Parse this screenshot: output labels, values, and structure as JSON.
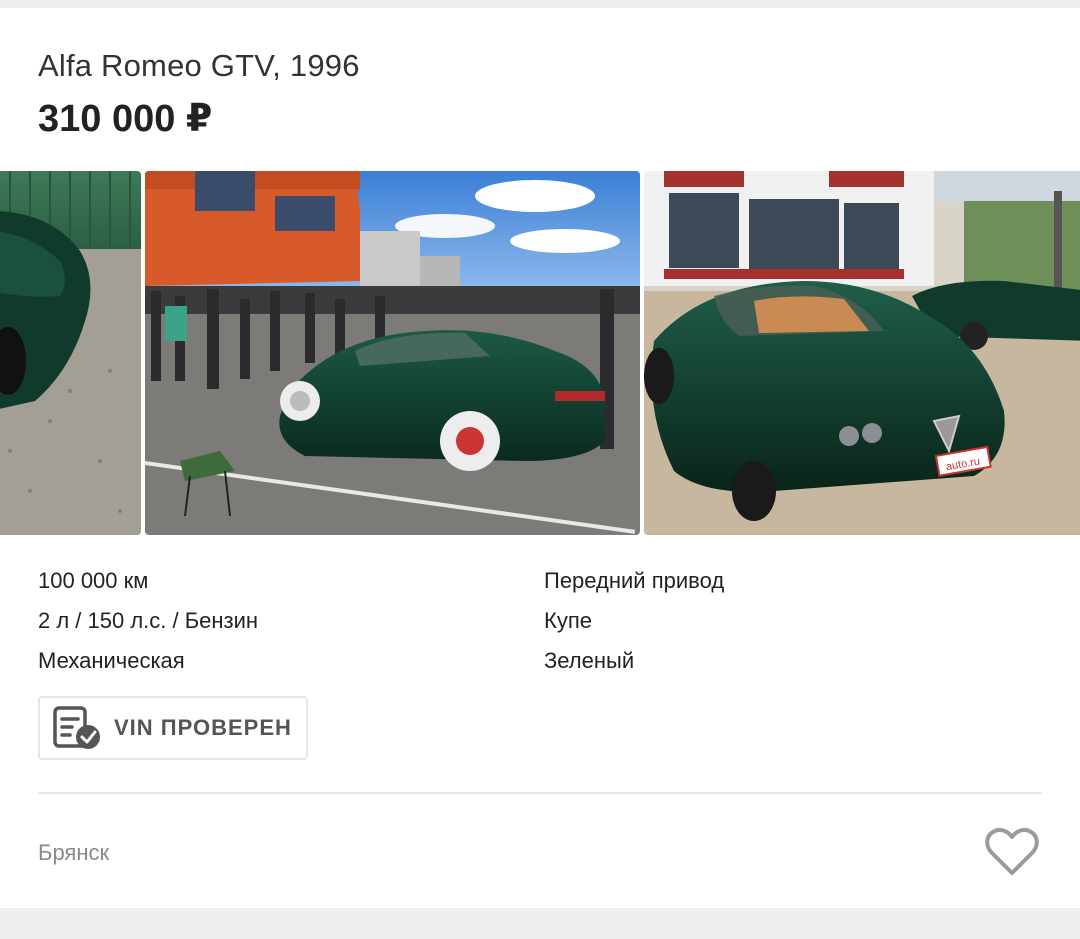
{
  "listing": {
    "title": "Alfa Romeo GTV, 1996",
    "price": "310 000 ₽"
  },
  "photos": [
    {
      "name": "car-photo-rear-left",
      "scene": "green car close-up on gravel"
    },
    {
      "name": "car-photo-parking-meet",
      "scene": "car at parking lot meet"
    },
    {
      "name": "car-photo-front",
      "scene": "car front view near building"
    }
  ],
  "specs": {
    "mileage": "100 000 км",
    "engine": "2 л / 150 л.с. / Бензин",
    "transmission": "Механическая",
    "drive": "Передний привод",
    "body": "Купе",
    "color": "Зеленый"
  },
  "vin_badge": {
    "label": "VIN ПРОВЕРЕН",
    "icon": "document-check-icon"
  },
  "location": {
    "city": "Брянск"
  },
  "favorite": {
    "icon": "heart-outline-icon"
  },
  "colors": {
    "car_green": "#0f3a2c",
    "text_primary": "#222222",
    "text_muted": "#8a8a8a",
    "border": "#e6e6e6"
  }
}
